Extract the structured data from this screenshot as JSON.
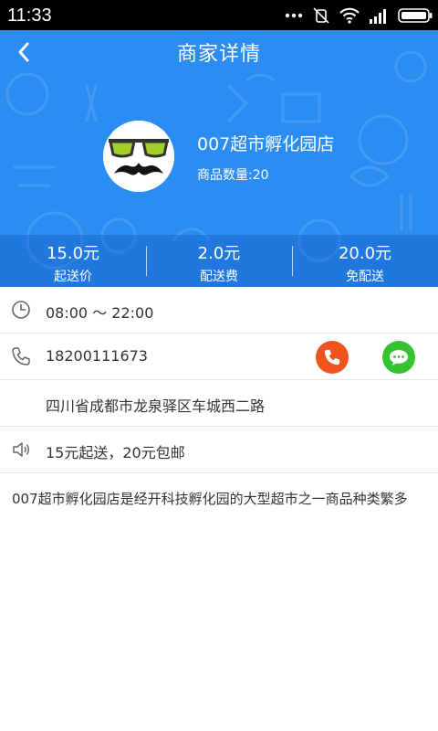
{
  "status_bar": {
    "time": "11:33",
    "icons": [
      "dots-icon",
      "mute-icon",
      "wifi-icon",
      "signal-icon",
      "battery-icon"
    ]
  },
  "header": {
    "title": "商家详情",
    "back_icon": "chevron-left-icon",
    "background_color": "#2b8cf2"
  },
  "shop": {
    "name": "007超市孵化园店",
    "goods_count": "商品数量:20"
  },
  "stats": [
    {
      "value": "15.0元",
      "label": "起送价"
    },
    {
      "value": "2.0元",
      "label": "配送费"
    },
    {
      "value": "20.0元",
      "label": "免配送"
    }
  ],
  "info": {
    "hours": "08:00 ～ 22:00",
    "phone": "18200111673",
    "address": "四川省成都市龙泉驿区车城西二路",
    "notice": "15元起送，20元包邮"
  },
  "actions": {
    "call_color": "#f0541e",
    "chat_color": "#35c332"
  },
  "description": "007超市孵化园店是经开科技孵化园的大型超市之一商品种类繁多"
}
